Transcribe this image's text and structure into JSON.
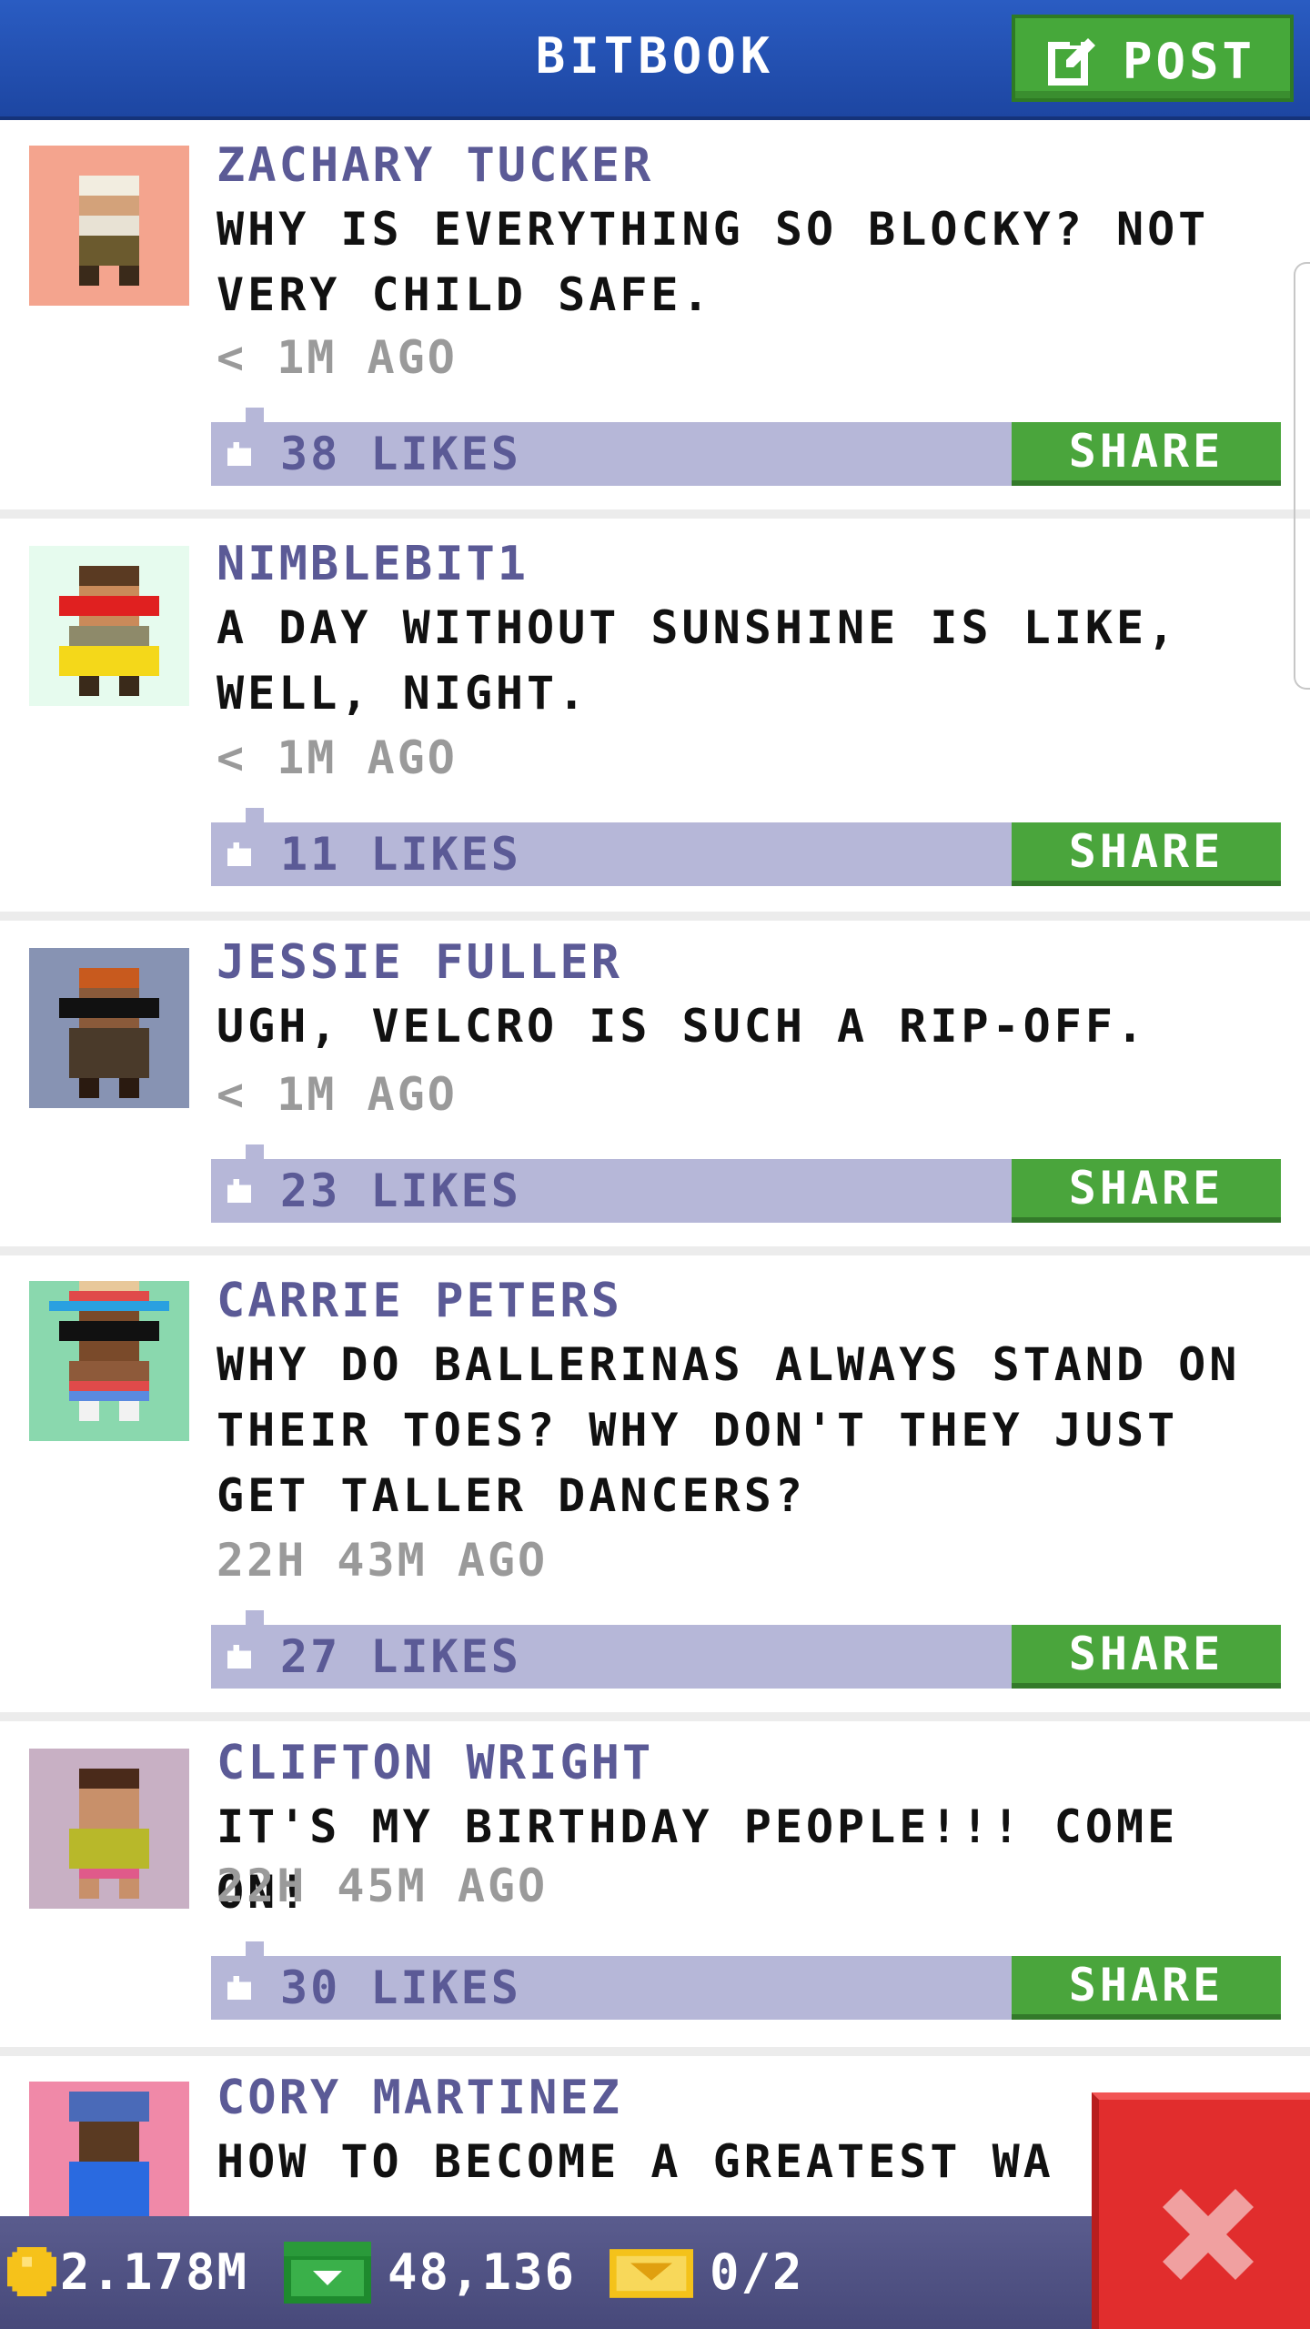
{
  "header": {
    "title": "BITBOOK",
    "post_button_label": "POST"
  },
  "posts": [
    {
      "author": "ZACHARY TUCKER",
      "message": "WHY IS EVERYTHING SO BLOCKY? NOT VERY CHILD SAFE.",
      "time": "< 1M AGO",
      "likes": "38 LIKES",
      "share": "SHARE",
      "avatar_bg": "#f4a48e"
    },
    {
      "author": "NIMBLEBIT1",
      "message": "A DAY WITHOUT SUNSHINE IS LIKE, WELL, NIGHT.",
      "time": "< 1M AGO",
      "likes": "11 LIKES",
      "share": "SHARE",
      "avatar_bg": "#e6fbee"
    },
    {
      "author": "JESSIE FULLER",
      "message": "UGH, VELCRO IS SUCH A RIP-OFF.",
      "time": "< 1M AGO",
      "likes": "23 LIKES",
      "share": "SHARE",
      "avatar_bg": "#8793b3"
    },
    {
      "author": "CARRIE PETERS",
      "message": "WHY DO BALLERINAS ALWAYS STAND ON THEIR TOES? WHY DON'T THEY JUST GET TALLER DANCERS?",
      "time": "22H 43M AGO",
      "likes": "27 LIKES",
      "share": "SHARE",
      "avatar_bg": "#8ad8ae"
    },
    {
      "author": "CLIFTON WRIGHT",
      "message": "IT'S MY BIRTHDAY PEOPLE!!! COME ON!",
      "time": "22H 45M AGO",
      "likes": "30 LIKES",
      "share": "SHARE",
      "avatar_bg": "#c8b0c4"
    },
    {
      "author": "CORY MARTINEZ",
      "message": "HOW TO BECOME A GREATEST WA",
      "avatar_bg": "#f089a8"
    }
  ],
  "footer": {
    "coins": "2.178M",
    "bux": "48,136",
    "tickets": "0/2"
  },
  "colors": {
    "header_blue": "#2a5cc2",
    "share_green": "#4aa53c",
    "likes_bar": "#b6b7d8",
    "author_purple": "#5b5a96",
    "close_red": "#e12d2d"
  }
}
